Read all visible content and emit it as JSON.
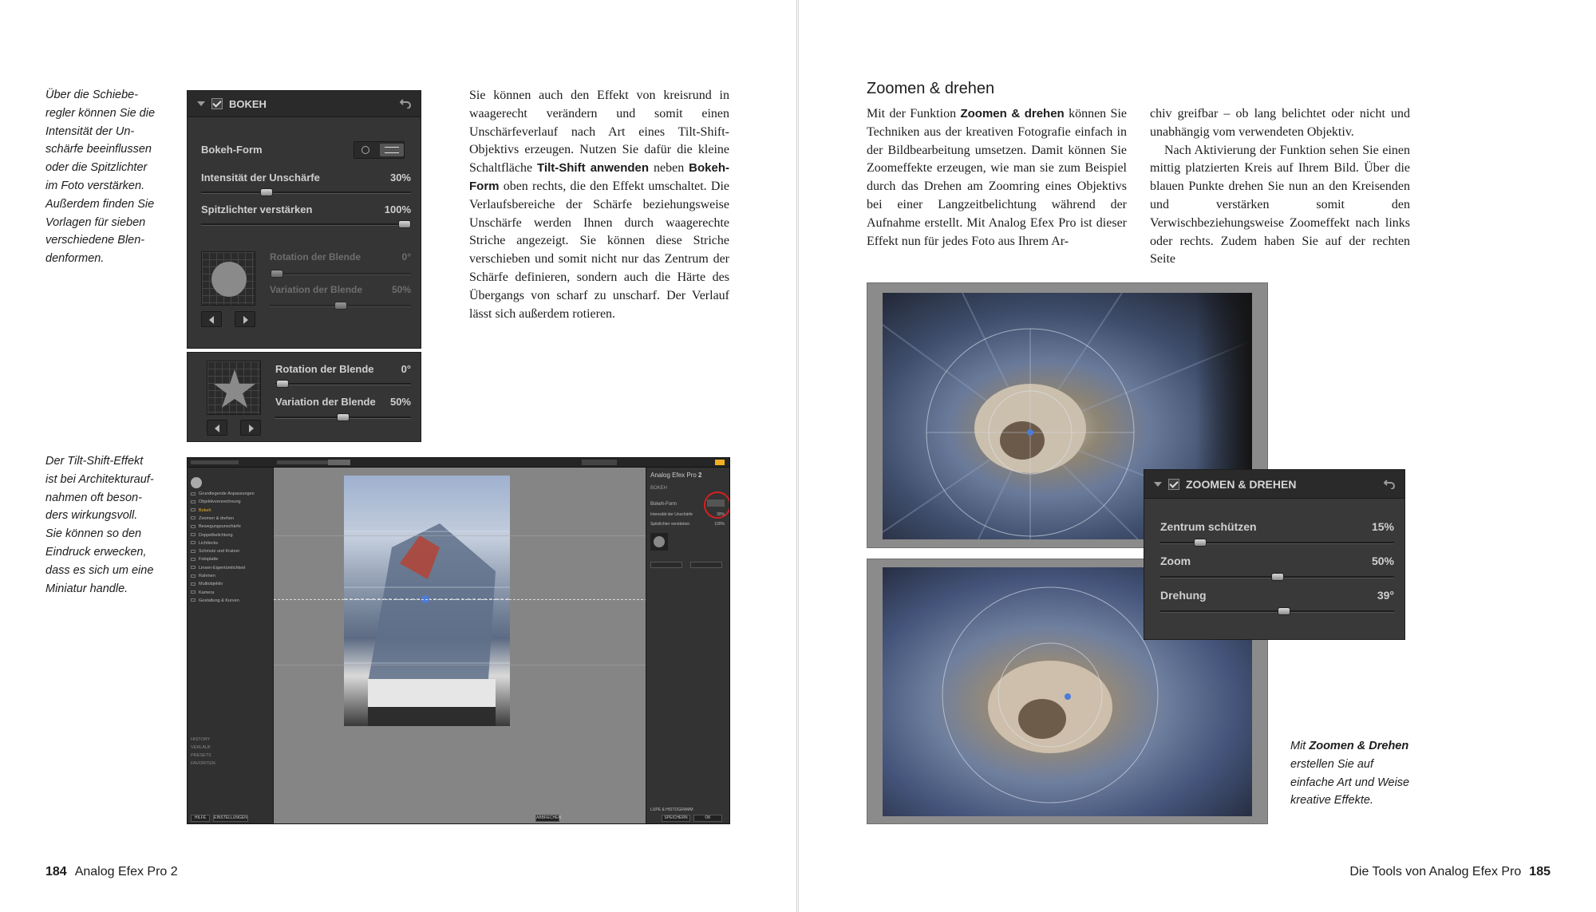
{
  "left_page": {
    "caption_top": [
      "Über die Schiebe-",
      "regler können Sie die",
      "Intensität der Un-",
      "schärfe beeinflussen",
      "oder die Spitzlichter",
      "im Foto verstärken.",
      "Außerdem finden Sie",
      "Vorlagen für sieben",
      "verschiedene Blen-",
      "denformen."
    ],
    "caption_bottom": [
      "Der Tilt-Shift-Effekt",
      "ist bei Architekturauf-",
      "nahmen oft beson-",
      "ders wirkungsvoll.",
      "Sie können so den",
      "Eindruck erwecken,",
      "dass es sich um eine",
      "Miniatur handle."
    ],
    "body": {
      "p1": "Sie können auch den Effekt von kreisrund in waagerecht verändern und somit einen Unschärfeverlauf nach Art eines Tilt-Shift-Objektivs erzeugen. Nutzen Sie dafür die kleine Schaltfläche",
      "bold1": "Tilt-Shift anwenden",
      "p2": " neben ",
      "bold2": "Bokeh-Form",
      "p3": " oben rechts, die den Effekt umschaltet. Die Verlaufsbereiche der Schärfe beziehungsweise Unschärfe werden Ihnen durch waagerechte Striche angezeigt. Sie können diese Striche verschieben und somit nicht nur das Zentrum der Schärfe definieren, sondern auch die Härte des Übergangs von scharf zu unscharf. Der Verlauf lässt sich außerdem rotieren."
    },
    "folio": {
      "number": "184",
      "title": "Analog Efex Pro 2"
    }
  },
  "bokeh_panel": {
    "title": "BOKEH",
    "shape_label": "Bokeh-Form",
    "intensity_label": "Intensität der Unschärfe",
    "intensity_value": "30%",
    "intensity_level": 0.3,
    "highlights_label": "Spitzlichter verstärken",
    "highlights_value": "100%",
    "highlights_level": 1.0,
    "rotation_label": "Rotation der Blende",
    "rotation_value": "0°",
    "variation_label": "Variation der Blende",
    "variation_value": "50%",
    "variation_level": 0.5
  },
  "star_panel": {
    "rotation_label": "Rotation der Blende",
    "rotation_value": "0°",
    "variation_label": "Variation der Blende",
    "variation_value": "50%",
    "variation_level": 0.5
  },
  "app_window": {
    "panel_title": "Analog Efex Pro",
    "panel_version": "2",
    "section": "BOKEH",
    "shape_label": "Bokeh-Form",
    "intensity_label": "Intensität der Unschärfe",
    "intensity_value": "30%",
    "highlights_label": "Spitzlichter verstärken",
    "highlights_value": "100%",
    "sidebar_items": [
      "Grundlegende Anpassungen",
      "Objektivverzeichnung",
      "Bokeh",
      "Zoomen & drehen",
      "Bewegungsunschärfe",
      "Doppelbelichtung",
      "Lichtlecks",
      "Schmutz und Kratzer",
      "Fotoplatte",
      "Linsen-Eigentümlichkeit",
      "Rahmen",
      "Multiobjektiv",
      "Kamera",
      "Gestaltung & Kurven"
    ],
    "sidebar_bottom": [
      "HISTORY",
      "VERLAUF",
      "PRESETS",
      "FAVORITEN"
    ],
    "loupe_label": "LUPE & HISTOGRAMM",
    "buttons": {
      "help": "HILFE",
      "settings": "EINSTELLUNGEN",
      "cancel": "ABBRECHEN",
      "save": "SPEICHERN",
      "ok": "OK"
    }
  },
  "right_page": {
    "heading": "Zoomen & drehen",
    "col1": {
      "p1": "Mit der Funktion ",
      "bold": "Zoomen & drehen",
      "p2": " können Sie Techniken aus der kreativen Fotografie einfach in der Bildbearbeitung umsetzen. Damit können Sie Zoomeffekte erzeugen, wie man sie zum Beispiel durch das Drehen am Zoomring eines Objektivs bei einer Langzeitbelichtung während der Aufnahme erstellt. Mit Analog Efex Pro ist dieser Effekt nun für jedes Foto aus Ihrem Ar-"
    },
    "col2": {
      "p1": "chiv greifbar – ob lang belichtet oder nicht und unabhängig vom verwendeten Objektiv.",
      "p2": "Nach Aktivierung der Funktion sehen Sie einen mittig platzierten Kreis auf Ihrem Bild. Über die blauen Punkte drehen Sie nun an den Kreisenden und verstärken somit den Verwischbeziehungsweise Zoomeffekt nach links oder rechts. Zudem haben Sie auf der rechten Seite"
    },
    "caption": {
      "pre": "Mit ",
      "bold": "Zoomen & Drehen",
      "post": " erstellen Sie auf einfache Art und Weise kreative Effekte."
    },
    "folio": {
      "title": "Die Tools von Analog Efex Pro",
      "number": "185"
    }
  },
  "zoom_panel": {
    "title": "ZOOMEN & DREHEN",
    "protect_label": "Zentrum schützen",
    "protect_value": "15%",
    "protect_level": 0.15,
    "zoom_label": "Zoom",
    "zoom_value": "50%",
    "zoom_level": 0.5,
    "rotate_label": "Drehung",
    "rotate_value": "39°",
    "rotate_level": 0.53
  },
  "colors": {
    "panel_bg": "#353535",
    "accent_red": "#d42020",
    "handle_blue": "#4c7bd8",
    "app_highlight": "#f0b020"
  }
}
